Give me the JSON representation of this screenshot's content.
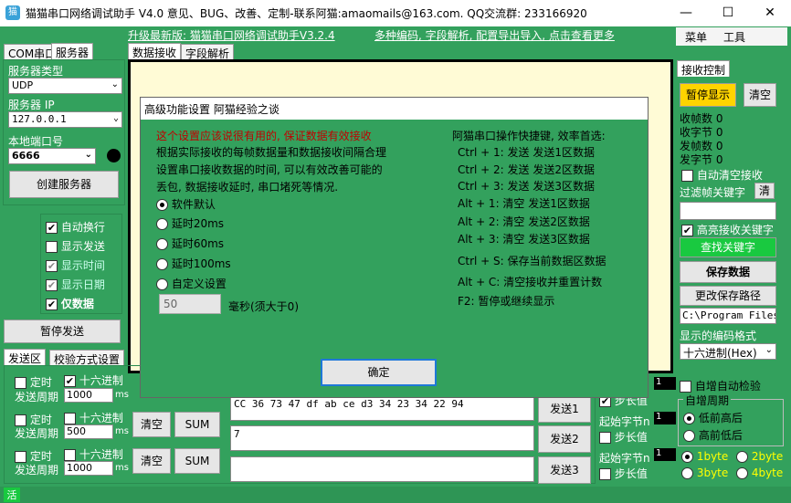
{
  "window": {
    "title": "猫猫串口网络调试助手 V4.0 意见、BUG、改善、定制-联系阿猫:amaomails@163.com. QQ交流群: 233166920",
    "minimize": "—",
    "maximize": "☐",
    "close": "✕"
  },
  "announce": {
    "upgrade": "升级最新版: 猫猫串口网络调试助手V3.2.4",
    "features": "多种编码, 字段解析, 配置导出导入, 点击查看更多"
  },
  "menubar": {
    "menu": "菜单",
    "tools": "工具"
  },
  "left": {
    "tabs": [
      "COM串口",
      "服务器"
    ],
    "server_type_label": "服务器类型",
    "server_type_value": "UDP",
    "server_ip_label": "服务器 IP",
    "server_ip_value": "127.0.0.1",
    "local_port_label": "本地端口号",
    "local_port_value": "6666",
    "create_server": "创建服务器",
    "options": [
      {
        "label": "自动换行",
        "checked": true
      },
      {
        "label": "显示发送",
        "checked": false
      },
      {
        "label": "显示时间",
        "checked": true
      },
      {
        "label": "显示日期",
        "checked": true
      },
      {
        "label": "仅数据",
        "checked": true
      }
    ],
    "pause_send": "暂停发送"
  },
  "center": {
    "tabs": [
      "数据接收",
      "字段解析"
    ]
  },
  "right": {
    "tab": "接收控制",
    "pause_display": "暂停显示",
    "clear": "清空",
    "recv_frames": "收帧数",
    "recv_frames_val": "0",
    "recv_bytes": "收字节",
    "recv_bytes_val": "0",
    "send_frames": "发帧数",
    "send_frames_val": "0",
    "send_bytes": "发字节",
    "send_bytes_val": "0",
    "auto_clear": "自动清空接收",
    "filter_label": "过滤帧关键字",
    "filter_clear": "清",
    "highlight": "高亮接收关键字",
    "find_keyword": "查找关键字",
    "save_data": "保存数据",
    "change_path": "更改保存路径",
    "path": "C:\\Program Files",
    "encoding_label": "显示的编码格式",
    "encoding_value": "十六进制(Hex)"
  },
  "bottom": {
    "tabs": [
      "发送区",
      "校验方式设置"
    ],
    "rows": [
      {
        "timed": "定时",
        "period_label": "发送周期",
        "hex": "十六进制",
        "hex_checked": true,
        "period": "1000",
        "unit": "ms",
        "data": "CC 36 73 47 df ab ce d3 34 23 34 22 94",
        "send": "发送1"
      },
      {
        "timed": "定时",
        "period_label": "发送周期",
        "hex": "十六进制",
        "hex_checked": false,
        "period": "500",
        "unit": "ms",
        "data": "7",
        "send": "发送2",
        "clear": "清空",
        "sum": "SUM"
      },
      {
        "timed": "定时",
        "period_label": "发送周期",
        "hex": "十六进制",
        "hex_checked": false,
        "period": "1000",
        "unit": "ms",
        "data": "",
        "send": "发送3",
        "clear": "清空",
        "sum": "SUM"
      }
    ],
    "start_byte": "起始字节n",
    "step": "步长值",
    "v1": "1",
    "auto_checksum": "自增自动检验",
    "auto_period": "自增周期",
    "low_high": "低前高后",
    "high_low": "高前低后",
    "b1": "1byte",
    "b2": "2byte",
    "b3": "3byte",
    "b4": "4byte",
    "status": "活"
  },
  "dialog": {
    "title": "高级功能设置 阿猫经验之谈",
    "warning": "这个设置应该说很有用的, 保证数据有效接收",
    "desc": [
      "根据实际接收的每帧数据量和数据接收间隔合理",
      "设置串口接收数据的时间, 可以有效改善可能的",
      "丢包, 数据接收延时, 串口堵死等情况."
    ],
    "options": [
      {
        "label": "软件默认",
        "on": true
      },
      {
        "label": "延时20ms",
        "on": false
      },
      {
        "label": "延时60ms",
        "on": false
      },
      {
        "label": "延时100ms",
        "on": false
      },
      {
        "label": "自定义设置",
        "on": false
      }
    ],
    "custom_value": "50",
    "custom_unit": "毫秒(须大于0)",
    "shortcuts_title": "阿猫串口操作快捷键, 效率首选:",
    "shortcuts": [
      "Ctrl + 1: 发送 发送1区数据",
      "Ctrl + 2: 发送 发送2区数据",
      "Ctrl + 3: 发送 发送3区数据",
      "Alt + 1: 清空 发送1区数据",
      "Alt + 2: 清空 发送2区数据",
      "Alt + 3: 清空 发送3区数据",
      "Ctrl + S: 保存当前数据区数据",
      "Alt + C: 清空接收并重置计数",
      "F2: 暂停或继续显示"
    ],
    "ok": "确定"
  }
}
